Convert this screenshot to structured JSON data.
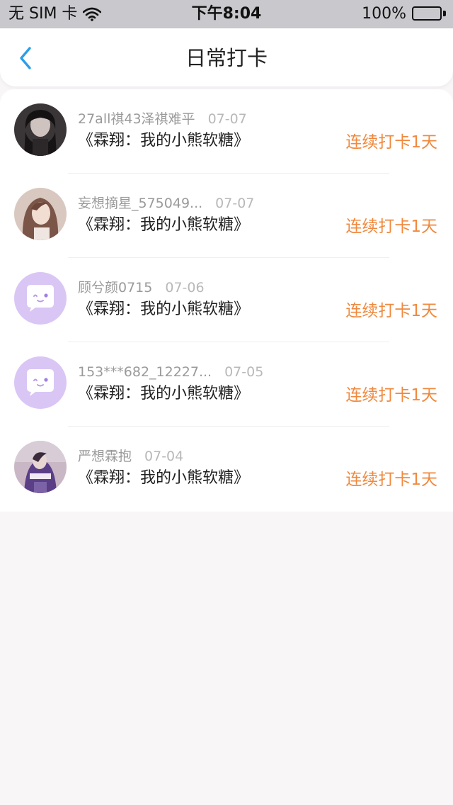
{
  "status_bar": {
    "carrier": "无 SIM 卡",
    "time": "下午8:04",
    "battery": "100%"
  },
  "nav": {
    "title": "日常打卡",
    "back_icon": "chevron-left-icon",
    "accent_color": "#2a9ee8"
  },
  "checkins": [
    {
      "username": "27all祺43泽祺难平",
      "date": "07-07",
      "title": "《霖翔：我的小熊软糖》",
      "streak": "连续打卡1天",
      "avatar": "photo-avatar-dark"
    },
    {
      "username": "妄想摘星_575049...",
      "date": "07-07",
      "title": "《霖翔：我的小熊软糖》",
      "streak": "连续打卡1天",
      "avatar": "photo-avatar-girl"
    },
    {
      "username": "顾兮颜0715",
      "date": "07-06",
      "title": "《霖翔：我的小熊软糖》",
      "streak": "连续打卡1天",
      "avatar": "default-chat-bubble-avatar"
    },
    {
      "username": "153***682_12227...",
      "date": "07-05",
      "title": "《霖翔：我的小熊软糖》",
      "streak": "连续打卡1天",
      "avatar": "default-chat-bubble-avatar"
    },
    {
      "username": "严想霖抱",
      "date": "07-04",
      "title": "《霖翔：我的小熊软糖》",
      "streak": "连续打卡1天",
      "avatar": "photo-avatar-purple"
    }
  ],
  "colors": {
    "streak": "#f0893e",
    "username": "#9a9a9a",
    "default_avatar": "#d9c6f5"
  }
}
